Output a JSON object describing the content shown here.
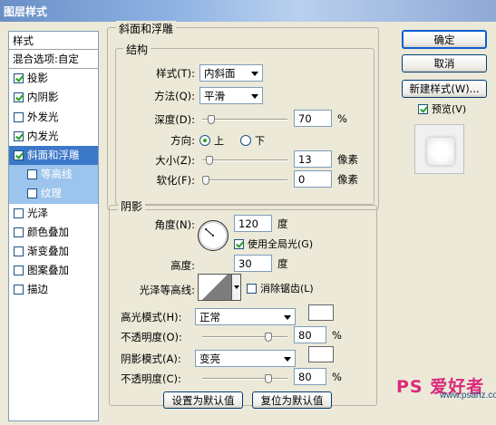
{
  "window": {
    "title": "图层样式"
  },
  "style_list": {
    "header": "样式",
    "blend_options": "混合选项:自定",
    "items": [
      {
        "label": "投影",
        "checked": true,
        "type": "normal"
      },
      {
        "label": "内阴影",
        "checked": true,
        "type": "normal"
      },
      {
        "label": "外发光",
        "checked": false,
        "type": "normal"
      },
      {
        "label": "内发光",
        "checked": true,
        "type": "normal"
      },
      {
        "label": "斜面和浮雕",
        "checked": true,
        "type": "selected"
      },
      {
        "label": "等高线",
        "checked": false,
        "type": "sub"
      },
      {
        "label": "纹理",
        "checked": false,
        "type": "sub"
      },
      {
        "label": "光泽",
        "checked": false,
        "type": "normal"
      },
      {
        "label": "颜色叠加",
        "checked": false,
        "type": "normal"
      },
      {
        "label": "渐变叠加",
        "checked": false,
        "type": "normal"
      },
      {
        "label": "图案叠加",
        "checked": false,
        "type": "normal"
      },
      {
        "label": "描边",
        "checked": false,
        "type": "normal"
      }
    ]
  },
  "bevel": {
    "section_title": "斜面和浮雕",
    "structure": {
      "title": "结构",
      "style_label": "样式(T):",
      "style_value": "内斜面",
      "technique_label": "方法(Q):",
      "technique_value": "平滑",
      "depth_label": "深度(D):",
      "depth_value": "70",
      "depth_unit": "%",
      "depth_fraction": 0.07,
      "direction_label": "方向:",
      "direction_up": "上",
      "direction_down": "下",
      "direction_selected": "上",
      "size_label": "大小(Z):",
      "size_value": "13",
      "size_unit": "像素",
      "size_fraction": 0.05,
      "soften_label": "软化(F):",
      "soften_value": "0",
      "soften_unit": "像素",
      "soften_fraction": 0.0
    },
    "shading": {
      "title": "阴影",
      "angle_label": "角度(N):",
      "angle_value": "120",
      "angle_unit": "度",
      "global_light_label": "使用全局光(G)",
      "global_light_checked": true,
      "altitude_label": "高度:",
      "altitude_value": "30",
      "altitude_unit": "度",
      "gloss_contour_label": "光泽等高线:",
      "anti_aliased_label": "消除锯齿(L)",
      "anti_aliased_checked": false,
      "highlight_mode_label": "高光模式(H):",
      "highlight_mode_value": "正常",
      "highlight_opacity_label": "不透明度(O):",
      "highlight_opacity_value": "80",
      "highlight_opacity_unit": "%",
      "highlight_opacity_fraction": 0.8,
      "shadow_mode_label": "阴影模式(A):",
      "shadow_mode_value": "变亮",
      "shadow_opacity_label": "不透明度(C):",
      "shadow_opacity_value": "80",
      "shadow_opacity_unit": "%",
      "shadow_opacity_fraction": 0.8,
      "highlight_color": "#ffffff",
      "shadow_color": "#ffffff"
    },
    "make_default_label": "设置为默认值",
    "reset_default_label": "复位为默认值"
  },
  "actions": {
    "ok_label": "确定",
    "cancel_label": "取消",
    "new_style_label": "新建样式(W)...",
    "preview_label": "预览(V)",
    "preview_checked": true
  },
  "watermark": {
    "main": "PS 爱好者",
    "sub": "www.psahz.com"
  },
  "colors": {
    "selected_bg": "#3c78c8",
    "sub_bg": "#9cc4ec",
    "dialog_bg": "#ece9d8",
    "watermark": "#d92a7c"
  }
}
